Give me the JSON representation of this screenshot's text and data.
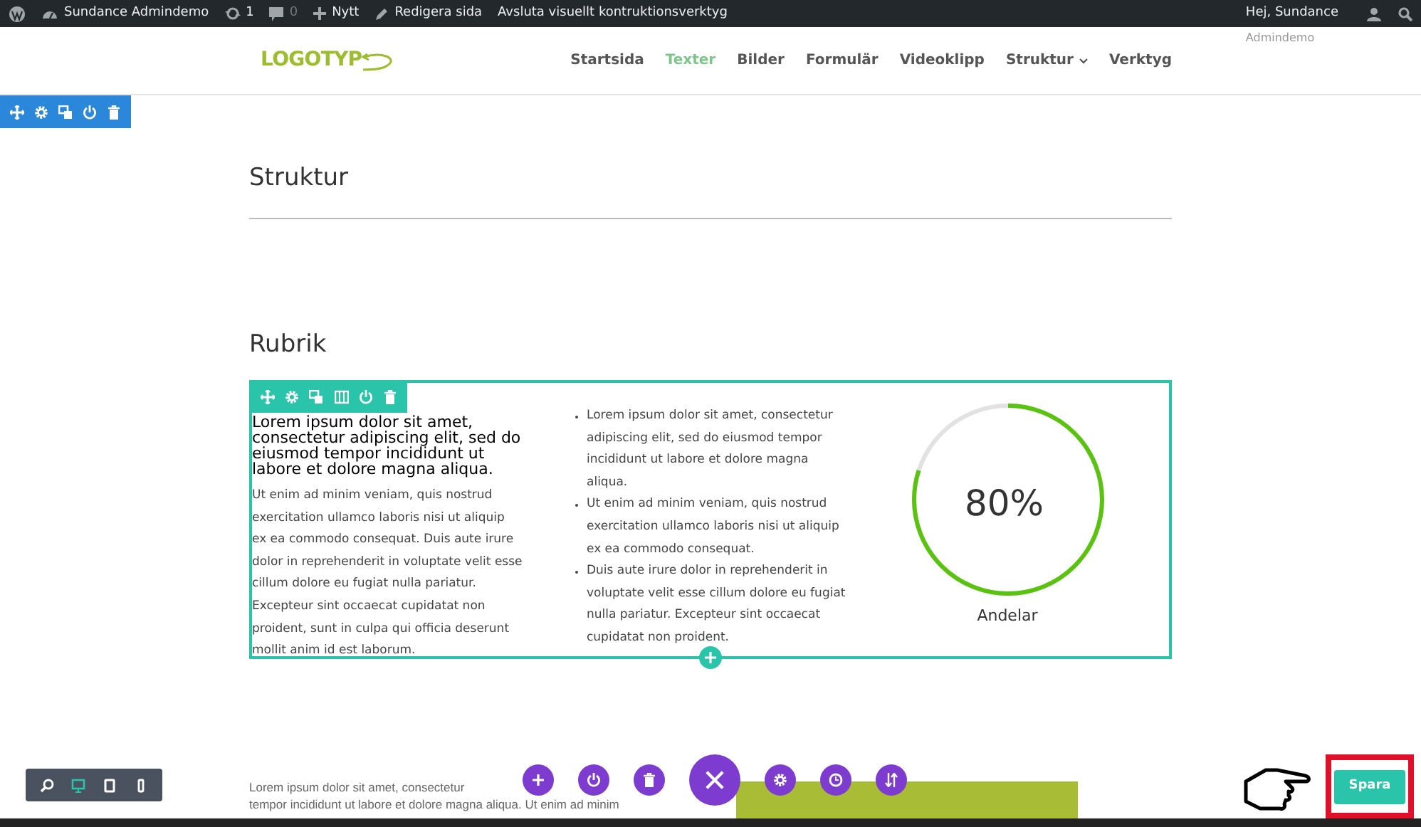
{
  "admin_bar": {
    "items": [
      {
        "kind": "wp"
      },
      {
        "kind": "site",
        "label": "Sundance Admindemo"
      },
      {
        "kind": "updates",
        "label": "1"
      },
      {
        "kind": "comments",
        "label": "0"
      },
      {
        "kind": "new",
        "label": "Nytt"
      },
      {
        "kind": "edit",
        "label": "Redigera sida"
      },
      {
        "kind": "text",
        "label": "Avsluta visuellt kontruktionsverktyg"
      }
    ],
    "greeting": "Hej, Sundance",
    "greeting_sub": "Admindemo"
  },
  "header": {
    "logo": "LOGOTYP",
    "nav": [
      {
        "label": "Startsida",
        "selected": false
      },
      {
        "label": "Texter",
        "selected": true
      },
      {
        "label": "Bilder",
        "selected": false
      },
      {
        "label": "Formulär",
        "selected": false
      },
      {
        "label": "Videoklipp",
        "selected": false
      },
      {
        "label": "Struktur",
        "selected": false,
        "dropdown": true
      },
      {
        "label": "Verktyg",
        "selected": false
      }
    ]
  },
  "section_title": "Struktur",
  "row_title": "Rubrik",
  "columns": [
    {
      "heading": "Lorem ipsum dolor sit amet, consectetur adipiscing elit, sed do eiusmod tempor incididunt ut labore et dolore magna aliqua.",
      "body": "Ut enim ad minim veniam, quis nostrud exercitation ullamco laboris nisi ut aliquip ex ea commodo consequat. Duis aute irure dolor in reprehenderit in voluptate velit esse cillum dolore eu fugiat nulla pariatur. Excepteur sint occaecat cupidatat non proident, sunt in culpa qui officia deserunt mollit anim id est laborum."
    },
    {
      "bullets": [
        "Lorem ipsum dolor sit amet, consectetur adipiscing elit, sed do eiusmod tempor incididunt ut labore et dolore magna aliqua.",
        "Ut enim ad minim veniam, quis nostrud exercitation ullamco laboris nisi ut aliquip ex ea commodo consequat.",
        "Duis aute irure dolor in reprehenderit in voluptate velit esse cillum dolore eu fugiat nulla pariatur. Excepteur sint occaecat cupidatat non proident."
      ]
    },
    {
      "counter": {
        "value": "80%",
        "level": 0.8,
        "label": "Andelar"
      }
    }
  ],
  "bottom_text": [
    "Lorem ipsum dolor sit amet, consectetur",
    "tempor incididunt ut labore et dolore magna aliqua. Ut enim ad minim"
  ],
  "view_modes": [
    {
      "kind": "zoom",
      "selected": false
    },
    {
      "kind": "desktop",
      "selected": true
    },
    {
      "kind": "tablet",
      "selected": false
    },
    {
      "kind": "phone",
      "selected": false
    }
  ],
  "save_button": "Spara"
}
